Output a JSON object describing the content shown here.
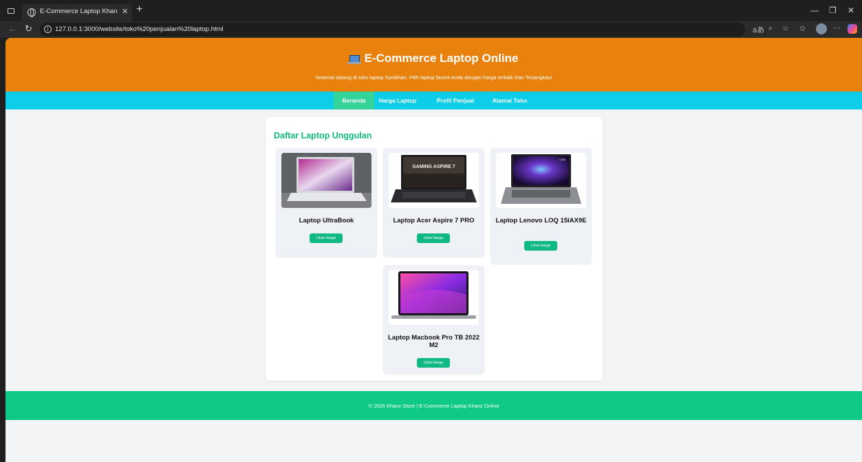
{
  "browser": {
    "tab_title": "E-Commerce Laptop Khanz Online",
    "new_tab_label": "+",
    "url": "127.0.0.1:3000/website/toko%20penjualan%20laptop.html",
    "read_aloud_label": "aあ"
  },
  "site": {
    "title": "E-Commerce Laptop Online",
    "subtitle": "Selamat datang di toko laptop Syeikhan. Pilih laptop favorit Anda dengan harga terbaik Dan Terjangkau!",
    "nav": [
      {
        "label": "Beranda",
        "active": true
      },
      {
        "label": "Harga Laptop",
        "active": false
      },
      {
        "label": "Profil Penjual",
        "active": false
      },
      {
        "label": "Alamat Toko",
        "active": false
      }
    ],
    "section_title": "Daftar Laptop Unggulan",
    "products": [
      {
        "name": "Laptop UltraBook",
        "button": "Lihat Harga"
      },
      {
        "name": "Laptop Acer Aspire 7 PRO",
        "button": "Lihat Harga",
        "screen_text": "GAMING ASPIRE 7"
      },
      {
        "name": "Laptop Lenovo LOQ 15IAX9E",
        "button": "Lihat Harga",
        "screen_text": "LOQ"
      },
      {
        "name": "Laptop Macbook Pro TB 2022 M2",
        "button": "Lihat Harga"
      }
    ],
    "footer": "© 2025 Khanz Store | E-Commerce Laptop Khanz Online"
  },
  "colors": {
    "header": "#e8820c",
    "nav": "#0dcde8",
    "nav_active": "#34d399",
    "accent": "#10b981",
    "footer": "#0fc987"
  }
}
